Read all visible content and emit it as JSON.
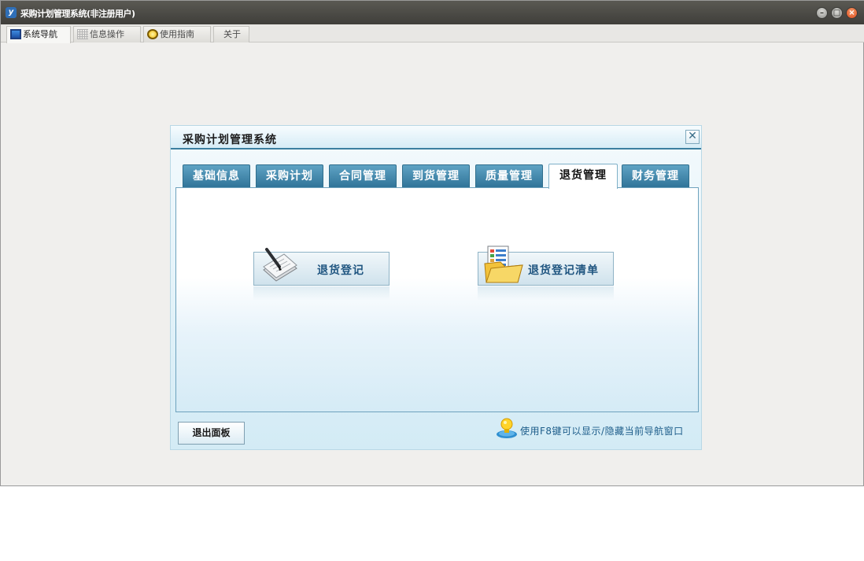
{
  "window": {
    "title": "采购计划管理系统(非注册用户)",
    "tabs": [
      {
        "label": "系统导航",
        "icon": "monitor-icon",
        "active": true
      },
      {
        "label": "信息操作",
        "icon": "grid-icon",
        "active": false
      },
      {
        "label": "使用指南",
        "icon": "help-icon",
        "active": false
      },
      {
        "label": "关于",
        "icon": "",
        "active": false
      }
    ],
    "controls": {
      "minimize": "–",
      "maximize": "□",
      "close": "×"
    }
  },
  "panel": {
    "title": "采购计划管理系统",
    "close_symbol": "✕",
    "tabs": [
      {
        "label": "基础信息",
        "active": false
      },
      {
        "label": "采购计划",
        "active": false
      },
      {
        "label": "合同管理",
        "active": false
      },
      {
        "label": "到货管理",
        "active": false
      },
      {
        "label": "质量管理",
        "active": false
      },
      {
        "label": "退货管理",
        "active": true
      },
      {
        "label": "财务管理",
        "active": false
      }
    ],
    "actions": [
      {
        "label": "退货登记",
        "icon": "edit-document-icon"
      },
      {
        "label": "退货登记清单",
        "icon": "folder-list-icon"
      }
    ],
    "exit_label": "退出面板",
    "hint": "使用F8键可以显示/隐藏当前导航窗口",
    "hint_icon": "lightbulb-icon"
  },
  "colors": {
    "tab_blue": "#2e7297",
    "accent_text": "#1f5580",
    "panel_border": "#3b7fa0"
  }
}
